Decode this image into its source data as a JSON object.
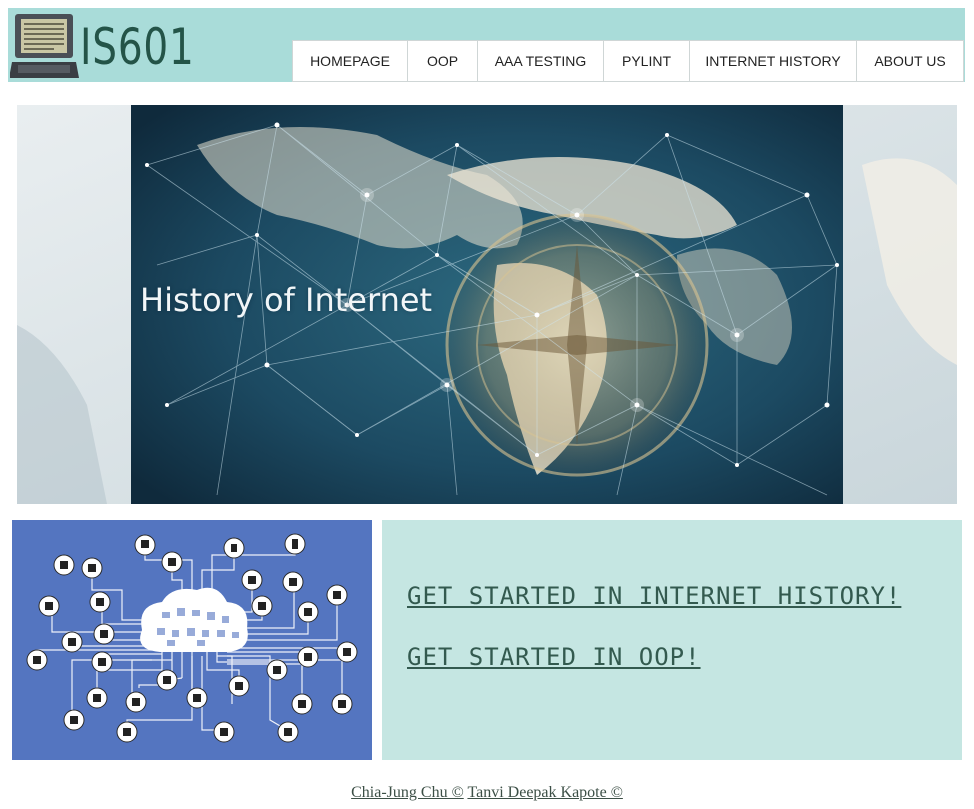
{
  "header": {
    "logo_text": "IS601"
  },
  "nav": {
    "items": [
      {
        "label": "HOMEPAGE"
      },
      {
        "label": "OOP"
      },
      {
        "label": "AAA TESTING"
      },
      {
        "label": "PYLINT"
      },
      {
        "label": "INTERNET HISTORY"
      },
      {
        "label": "ABOUT US"
      }
    ]
  },
  "hero": {
    "title": "History of Internet"
  },
  "cta": {
    "internet_history": "GET STARTED IN INTERNET HISTORY!",
    "oop": "GET STARTED IN OOP!"
  },
  "footer": {
    "author1": "Chia-Jung Chu ©",
    "author2": "Tanvi Deepak Kapote ©"
  },
  "colors": {
    "header_bg": "#a9dcd9",
    "logo_text": "#245448",
    "cta_bg": "#c5e6e2",
    "iot_bg": "#5475c0",
    "link": "#335a4f"
  }
}
